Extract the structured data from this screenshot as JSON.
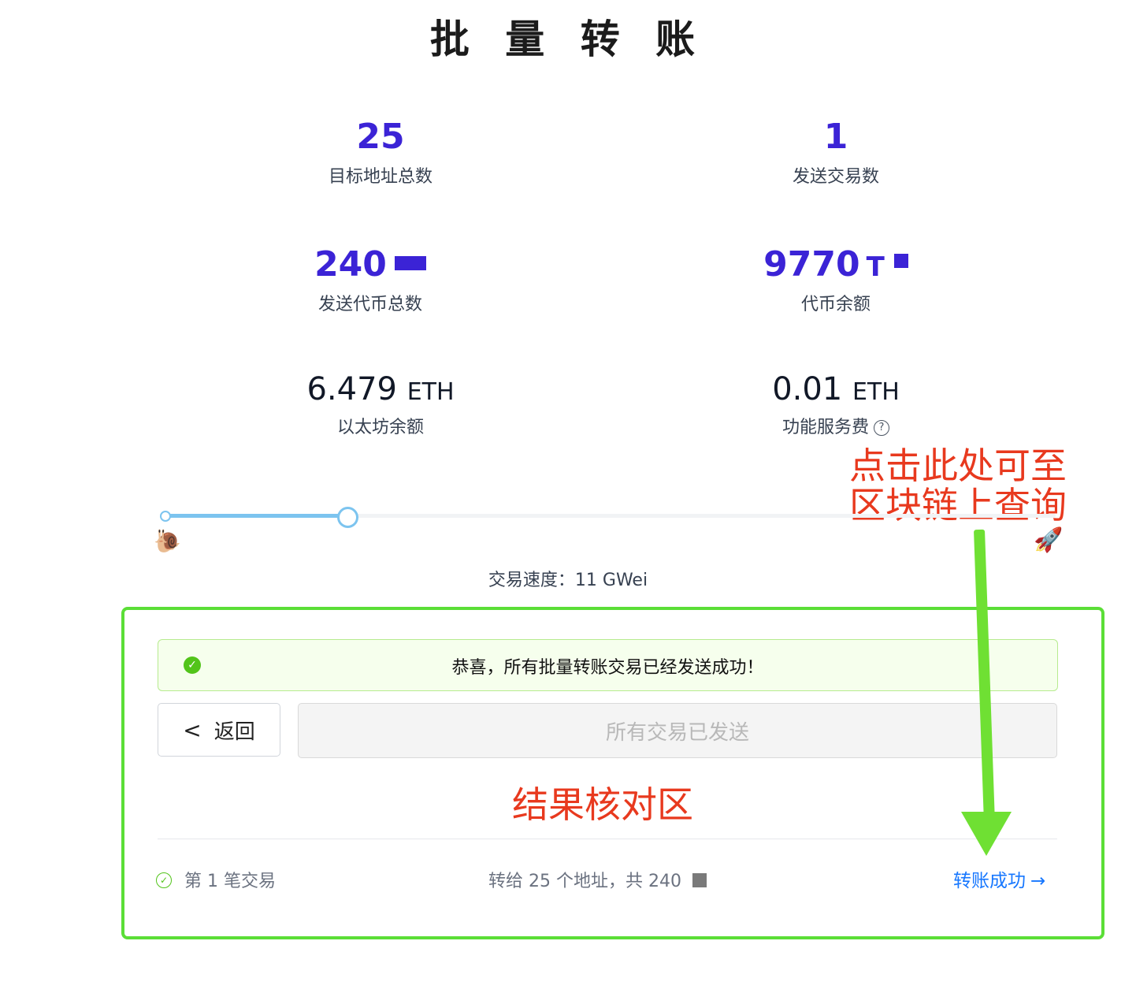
{
  "page": {
    "title": "批 量 转 账"
  },
  "stats": {
    "target_addresses": {
      "value": "25",
      "label": "目标地址总数"
    },
    "tx_count": {
      "value": "1",
      "label": "发送交易数"
    },
    "token_total": {
      "value": "240",
      "label": "发送代币总数"
    },
    "token_balance": {
      "value": "9770",
      "unit_letter": "T",
      "label": "代币余额"
    },
    "eth_balance": {
      "value": "6.479",
      "unit": "ETH",
      "label": "以太坊余额"
    },
    "service_fee": {
      "value": "0.01",
      "unit": "ETH",
      "label": "功能服务费",
      "help": "?"
    }
  },
  "speed": {
    "text": "交易速度：11 GWei",
    "slider_fraction": 0.21,
    "slow_icon": "🐌",
    "fast_icon": "🚀"
  },
  "alert": {
    "message": "恭喜，所有批量转账交易已经发送成功！",
    "icon": "✓"
  },
  "buttons": {
    "back_chevron": "<",
    "back": "返回",
    "sent": "所有交易已发送"
  },
  "annotations": {
    "query": "点击此处可至\n区块链上查询",
    "query_line1": "点击此处可至",
    "query_line2": "区块链上查询",
    "result": "结果核对区"
  },
  "transaction": {
    "index": "第 1 笔交易",
    "detail": "转给 25 个地址，共 240",
    "status_link": "转账成功",
    "arrow": "→",
    "check": "✓"
  },
  "colors": {
    "primary": "#3b23d6",
    "success": "#52c41a",
    "link": "#1677ff",
    "annotation": "#e8391e",
    "highlight": "#5bde37"
  }
}
